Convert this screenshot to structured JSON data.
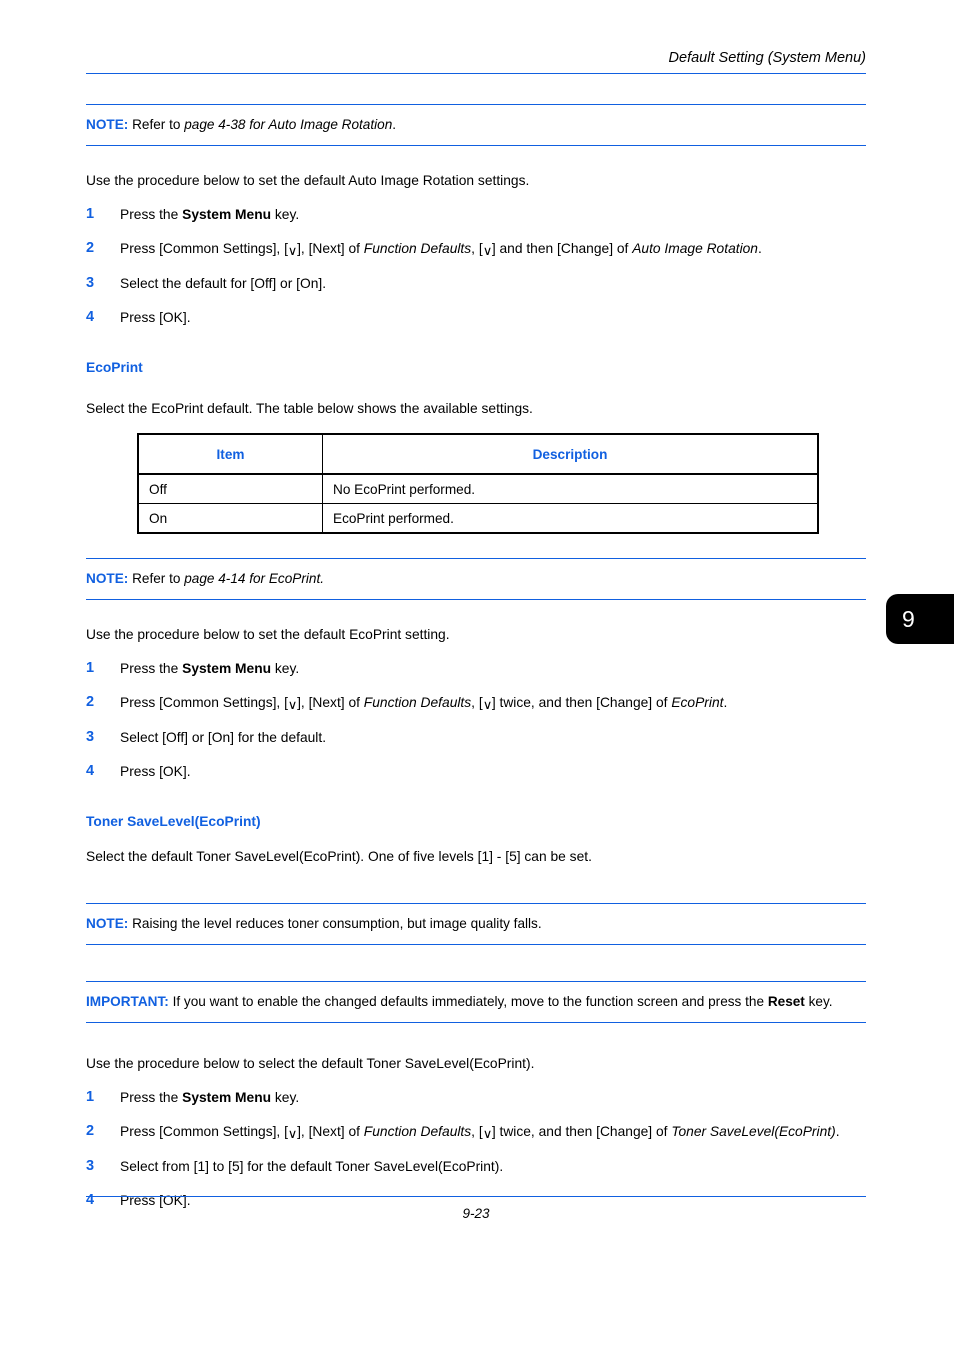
{
  "header": {
    "title": "Default Setting (System Menu)"
  },
  "notes": {
    "auto_image_rotation": {
      "label": "NOTE:",
      "text_before": "Refer to ",
      "italic": "page 4-38 for Auto Image Rotation",
      "text_after": "."
    },
    "ecoprint": {
      "label": "NOTE:",
      "text_before": "Refer to ",
      "italic": "page 4-14 for EcoPrint.",
      "text_after": ""
    },
    "toner_level": {
      "label": "NOTE:",
      "text_before": "Raising the level reduces toner consumption, but image quality falls.",
      "italic": "",
      "text_after": ""
    }
  },
  "important": {
    "label": "IMPORTANT:",
    "text_before": "If you want to enable the changed defaults immediately, move to the function screen and press the ",
    "bold": "Reset",
    "text_after": " key."
  },
  "intro": {
    "auto_image_rotation": "Use the procedure below to set the default Auto Image Rotation settings.",
    "ecoprint": "Use the procedure below to set the default EcoPrint setting.",
    "toner_level": "Use the procedure below to select the default Toner SaveLevel(EcoPrint)."
  },
  "headings": {
    "ecoprint": "EcoPrint",
    "toner_savelevel": "Toner SaveLevel(EcoPrint)"
  },
  "ecoprint_desc": "Select the EcoPrint default. The table below shows the available settings.",
  "toner_desc": "Select the default Toner SaveLevel(EcoPrint). One of five levels [1] - [5] can be set.",
  "icons": {
    "chevron_down": "∨"
  },
  "procedure_rotation": {
    "steps": [
      {
        "num": "1",
        "p1": "Press the ",
        "b1": "System Menu",
        "p2": " key.",
        "i1": "",
        "p3": "",
        "i2": "",
        "p4": ""
      },
      {
        "num": "2",
        "p1": "Press [Common Settings], [",
        "b1": "",
        "p2": "], [Next] of ",
        "i1": "Function Defaults",
        "p3": ", [",
        "i2": "",
        "p4": "] and then [Change] of ",
        "i3": "Auto Image Rotation",
        "p5": "."
      },
      {
        "num": "3",
        "p1": "Select the default for [Off] or [On].",
        "b1": "",
        "p2": "",
        "i1": "",
        "p3": "",
        "i2": "",
        "p4": ""
      },
      {
        "num": "4",
        "p1": "Press [OK].",
        "b1": "",
        "p2": "",
        "i1": "",
        "p3": "",
        "i2": "",
        "p4": ""
      }
    ]
  },
  "procedure_ecoprint": {
    "steps": [
      {
        "num": "1",
        "p1": "Press the ",
        "b1": "System Menu",
        "p2": " key."
      },
      {
        "num": "2",
        "p1": "Press [Common Settings], [",
        "p2": "], [Next] of ",
        "i1": "Function Defaults",
        "p3": ", [",
        "p4": "] twice, and then [Change] of ",
        "i3": "EcoPrint",
        "p5": "."
      },
      {
        "num": "3",
        "p1": "Select [Off] or [On] for the default."
      },
      {
        "num": "4",
        "p1": "Press [OK]."
      }
    ]
  },
  "procedure_toner": {
    "steps": [
      {
        "num": "1",
        "p1": "Press the ",
        "b1": "System Menu",
        "p2": " key."
      },
      {
        "num": "2",
        "p1": "Press [Common Settings], [",
        "p2": "], [Next] of ",
        "i1": "Function Defaults",
        "p3": ", [",
        "p4": "] twice, and then [Change] of ",
        "i3": "Toner SaveLevel(EcoPrint)",
        "p5": "."
      },
      {
        "num": "3",
        "p1": "Select from [1] to [5] for the default Toner SaveLevel(EcoPrint)."
      },
      {
        "num": "4",
        "p1": "Press [OK]."
      }
    ]
  },
  "table": {
    "headers": [
      "Item",
      "Description"
    ],
    "rows": [
      [
        "Off",
        "No EcoPrint performed."
      ],
      [
        "On",
        "EcoPrint performed."
      ]
    ]
  },
  "chapter_tab": "9",
  "footer": {
    "page_number": "9-23"
  },
  "colors": {
    "accent_blue": "#1160E0",
    "text_black": "#000000"
  }
}
